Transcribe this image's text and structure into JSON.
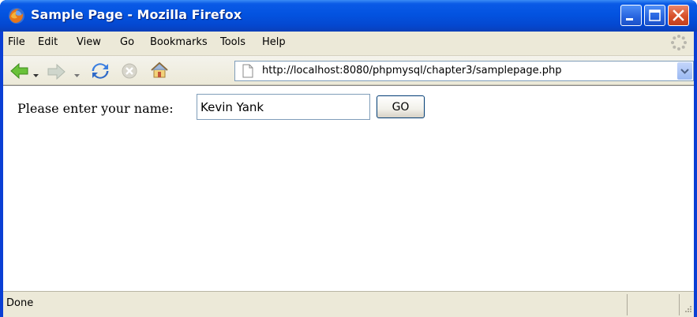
{
  "window": {
    "title": "Sample Page - Mozilla Firefox"
  },
  "menu": {
    "items": [
      "File",
      "Edit",
      "View",
      "Go",
      "Bookmarks",
      "Tools",
      "Help"
    ]
  },
  "navigation": {
    "url": "http://localhost:8080/phpmysql/chapter3/samplepage.php"
  },
  "page": {
    "prompt_label": "Please enter your name:",
    "name_value": "Kevin Yank",
    "go_label": "GO"
  },
  "status": {
    "text": "Done"
  },
  "colors": {
    "titlebar": "#0353e0",
    "chrome": "#ece9d8",
    "close_button": "#d8502a"
  },
  "icons": {
    "app": "firefox-icon",
    "back": "back-arrow-icon",
    "forward": "forward-arrow-icon",
    "reload": "reload-icon",
    "stop": "stop-icon",
    "home": "home-icon",
    "throbber": "throbber-icon"
  }
}
